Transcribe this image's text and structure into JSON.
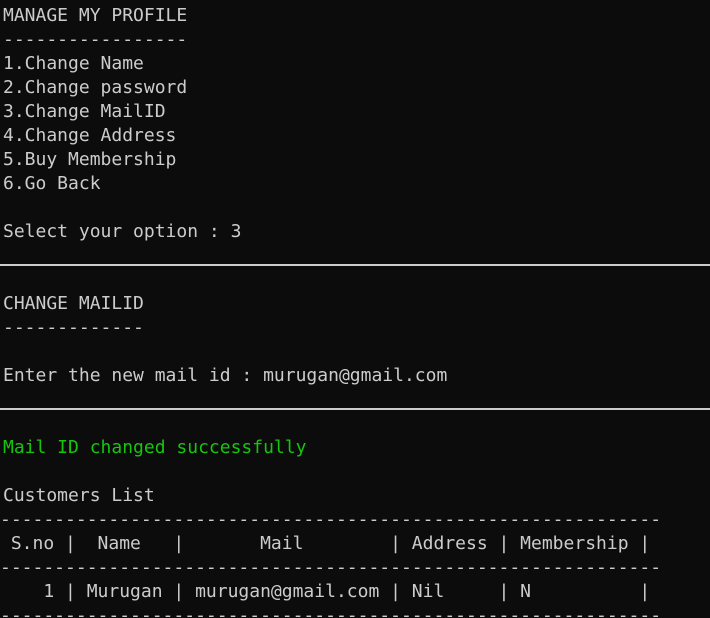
{
  "colors": {
    "background": "#0c0c0c",
    "text": "#cccccc",
    "success": "#16c60c"
  },
  "profile_menu": {
    "title": "MANAGE MY PROFILE",
    "underline": "-----------------",
    "options": [
      "1.Change Name",
      "2.Change password",
      "3.Change MailID",
      "4.Change Address",
      "5.Buy Membership",
      "6.Go Back"
    ],
    "prompt": "Select your option : 3"
  },
  "change_mail": {
    "title": "CHANGE MAILID",
    "underline": "-------------",
    "prompt": "Enter the new mail id : murugan@gmail.com"
  },
  "result": {
    "message": "Mail ID changed successfully"
  },
  "customers_table": {
    "title": "Customers List",
    "border_top": "-------------------------------------------------------------",
    "header": " S.no |  Name   |       Mail        | Address | Membership |",
    "border_mid": "-------------------------------------------------------------",
    "rows": [
      "    1 | Murugan | murugan@gmail.com | Nil     | N          |"
    ],
    "border_bottom": "-------------------------------------------------------------"
  }
}
